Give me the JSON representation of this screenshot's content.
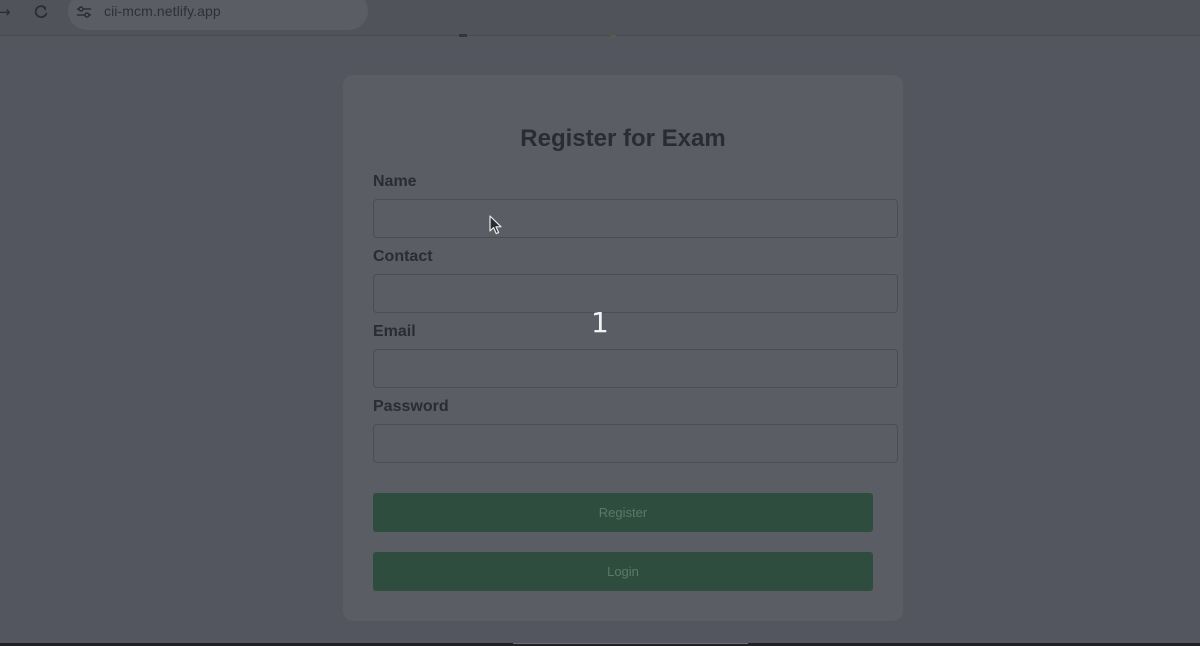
{
  "browser": {
    "url": "cii-mcm.netlify.app",
    "forward_icon": "arrow-forward-icon",
    "reload_icon": "reload-icon",
    "site_info_icon": "tune-icon"
  },
  "form": {
    "title": "Register for Exam",
    "fields": [
      {
        "label": "Name",
        "value": ""
      },
      {
        "label": "Contact",
        "value": ""
      },
      {
        "label": "Email",
        "value": ""
      },
      {
        "label": "Password",
        "value": ""
      }
    ],
    "register_label": "Register",
    "login_label": "Login"
  },
  "overlay": {
    "number": "1"
  },
  "colors": {
    "page_background": "#53565e",
    "card_background": "#5a5d64",
    "button_background": "#2f4d3f",
    "button_text": "#5e7867",
    "title_text": "#2a2c30"
  }
}
